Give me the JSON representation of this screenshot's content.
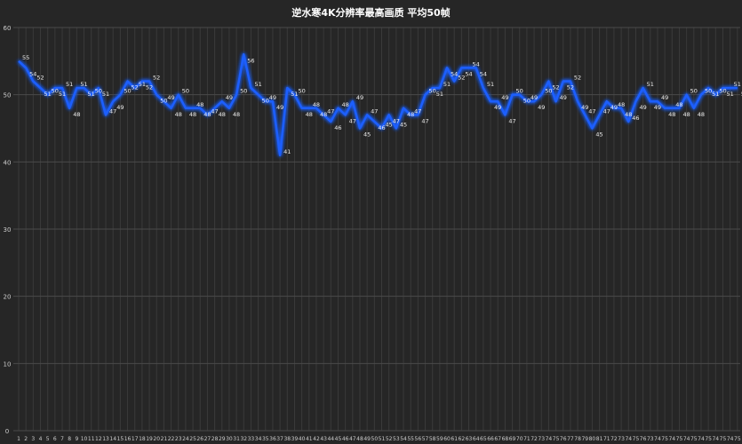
{
  "chart_data": {
    "type": "line",
    "title": "逆水寒4K分辨率最高画质 平均50帧",
    "xlabel": "",
    "ylabel": "",
    "ylim": [
      0,
      60
    ],
    "yticks": [
      0,
      10,
      20,
      30,
      40,
      50,
      60
    ],
    "grid": true,
    "line_color": "#1f5fff",
    "categories": [
      "1",
      "2",
      "3",
      "4",
      "5",
      "6",
      "7",
      "8",
      "9",
      "10",
      "11",
      "12",
      "13",
      "14",
      "15",
      "16",
      "17",
      "18",
      "19",
      "20",
      "21",
      "22",
      "23",
      "24",
      "25",
      "26",
      "27",
      "28",
      "29",
      "30",
      "31",
      "32",
      "33",
      "34",
      "35",
      "36",
      "37",
      "38",
      "39",
      "40",
      "41",
      "42",
      "43",
      "44",
      "45",
      "46",
      "47",
      "48",
      "49",
      "50",
      "51",
      "52",
      "53",
      "54",
      "55",
      "56",
      "57",
      "58",
      "59",
      "60",
      "61",
      "62",
      "63",
      "64",
      "65",
      "66",
      "67",
      "68",
      "69",
      "70",
      "71",
      "72",
      "73",
      "74",
      "75",
      "76",
      "77",
      "78",
      "79",
      "80",
      "81",
      "71",
      "72",
      "73",
      "74",
      "75",
      "76",
      "73",
      "74",
      "75",
      "74",
      "75",
      "74",
      "75",
      "74",
      "75",
      "74",
      "75",
      "74",
      "75"
    ],
    "values": [
      55,
      54,
      52,
      51,
      50,
      51,
      51,
      48,
      51,
      51,
      50,
      51,
      47,
      49,
      50,
      52,
      51,
      52,
      52,
      50,
      49,
      48,
      50,
      48,
      48,
      48,
      47,
      48,
      49,
      48,
      50,
      56,
      51,
      50,
      49,
      49,
      41,
      51,
      50,
      48,
      48,
      48,
      47,
      46,
      48,
      47,
      49,
      45,
      47,
      46,
      45,
      47,
      45,
      48,
      47,
      47,
      50,
      51,
      51,
      54,
      52,
      54,
      54,
      54,
      51,
      49,
      49,
      47,
      50,
      50,
      49,
      49,
      50,
      52,
      49,
      52,
      52,
      49,
      47,
      45,
      47,
      49,
      48,
      48,
      46,
      49,
      51,
      49,
      49,
      48,
      48,
      48,
      50,
      48,
      50,
      51,
      50,
      51,
      51,
      51
    ]
  }
}
